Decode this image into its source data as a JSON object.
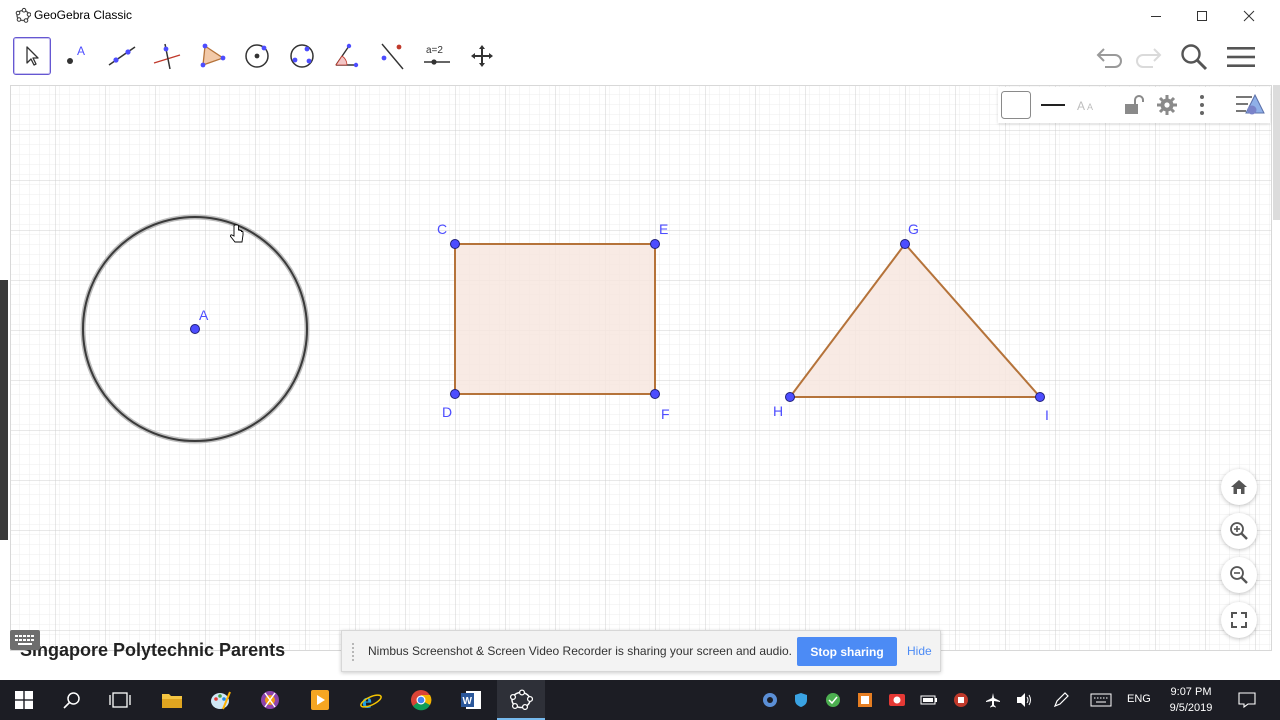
{
  "window": {
    "title": "GeoGebra Classic"
  },
  "toolbar": {
    "tools": [
      {
        "name": "move-tool",
        "icon": "arrow-pointer-icon"
      },
      {
        "name": "point-tool",
        "icon": "point-icon"
      },
      {
        "name": "line-tool",
        "icon": "line-icon"
      },
      {
        "name": "perpendicular-line-tool",
        "icon": "perpendicular-icon"
      },
      {
        "name": "polygon-tool",
        "icon": "polygon-icon"
      },
      {
        "name": "circle-center-point-tool",
        "icon": "circle-icon"
      },
      {
        "name": "ellipse-tool",
        "icon": "ellipse-icon"
      },
      {
        "name": "angle-tool",
        "icon": "angle-icon"
      },
      {
        "name": "reflect-tool",
        "icon": "reflect-icon"
      },
      {
        "name": "slider-tool",
        "icon": "slider-icon",
        "label": "a=2"
      },
      {
        "name": "move-graphics-view-tool",
        "icon": "move-arrows-icon"
      }
    ],
    "active_tool": "move-tool"
  },
  "graphics": {
    "points": [
      {
        "label": "A"
      },
      {
        "label": "C"
      },
      {
        "label": "E"
      },
      {
        "label": "D"
      },
      {
        "label": "F"
      },
      {
        "label": "G"
      },
      {
        "label": "H"
      },
      {
        "label": "I"
      }
    ],
    "colors": {
      "point": "#4d4dff",
      "polygon_stroke": "#b5733a",
      "polygon_fill": "#f7e6df",
      "circle_stroke": "#3a3a3a",
      "grid_minor": "#ececec",
      "grid_major": "#d0d0d0"
    }
  },
  "behind_text": "Singapore Polytechnic Parents",
  "share_banner": {
    "message": "Nimbus Screenshot & Screen Video Recorder is sharing your screen and audio.",
    "stop_label": "Stop sharing",
    "hide_label": "Hide"
  },
  "taskbar": {
    "language": "ENG",
    "time": "9:07 PM",
    "date": "9/5/2019"
  }
}
